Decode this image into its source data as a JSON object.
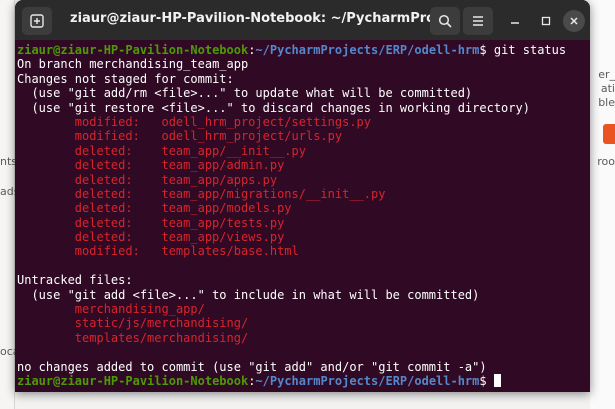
{
  "window": {
    "title": "ziaur@ziaur-HP-Pavilion-Notebook: ~/PycharmProjects/ERP/..."
  },
  "background": {
    "left_labels": [
      "nts",
      "ads",
      "oca"
    ],
    "right_labels": [
      "er_",
      "ati",
      "ble",
      "roo"
    ]
  },
  "terminal": {
    "prompt1": {
      "user": "ziaur@ziaur-HP-Pavilion-Notebook",
      "path": "~/PycharmProjects/ERP/odell-hrm",
      "command": "$ git status"
    },
    "branch_line": "On branch merchandising_team_app",
    "not_staged_header": "Changes not staged for commit:",
    "hint1": "  (use \"git add/rm <file>...\" to update what will be committed)",
    "hint2": "  (use \"git restore <file>...\" to discard changes in working directory)",
    "changes": [
      {
        "status": "modified:",
        "file": "odell_hrm_project/settings.py"
      },
      {
        "status": "modified:",
        "file": "odell_hrm_project/urls.py"
      },
      {
        "status": "deleted:",
        "file": "team_app/__init__.py"
      },
      {
        "status": "deleted:",
        "file": "team_app/admin.py"
      },
      {
        "status": "deleted:",
        "file": "team_app/apps.py"
      },
      {
        "status": "deleted:",
        "file": "team_app/migrations/__init__.py"
      },
      {
        "status": "deleted:",
        "file": "team_app/models.py"
      },
      {
        "status": "deleted:",
        "file": "team_app/tests.py"
      },
      {
        "status": "deleted:",
        "file": "team_app/views.py"
      },
      {
        "status": "modified:",
        "file": "templates/base.html"
      }
    ],
    "untracked_header": "Untracked files:",
    "untracked_hint": "  (use \"git add <file>...\" to include in what will be committed)",
    "untracked": [
      "merchandising_app/",
      "static/js/merchandising/",
      "templates/merchandising/"
    ],
    "summary": "no changes added to commit (use \"git add\" and/or \"git commit -a\")",
    "prompt2": {
      "user": "ziaur@ziaur-HP-Pavilion-Notebook",
      "path": "~/PycharmProjects/ERP/odell-hrm",
      "symbol": "$ "
    }
  },
  "colors": {
    "terminal_bg": "#300a24",
    "user": "#4e9a06",
    "path": "#5487cb",
    "red": "#d8242c",
    "titlebar": "#2b2b2b"
  },
  "icons": [
    "new-tab-icon",
    "search-icon",
    "hamburger-menu-icon",
    "minimize-icon",
    "maximize-icon",
    "close-icon"
  ]
}
